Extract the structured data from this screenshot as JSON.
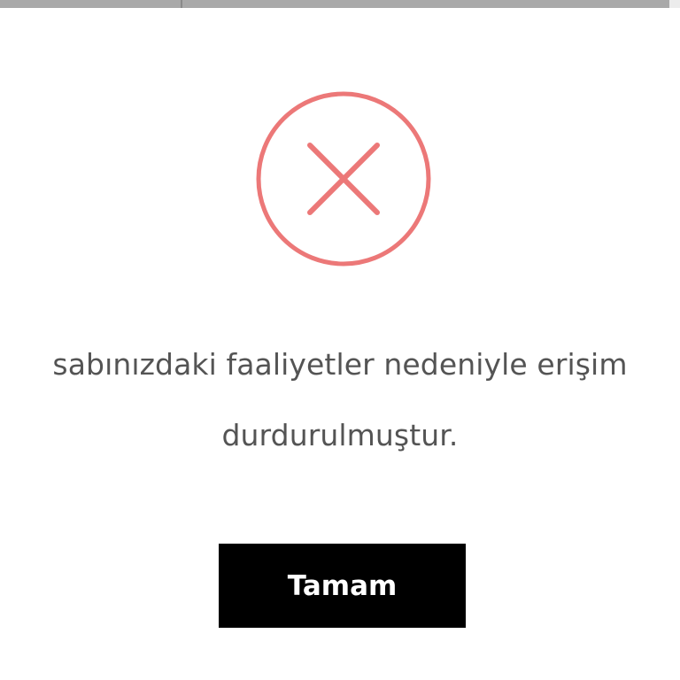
{
  "dialog": {
    "message_line_1": "sabınızdaki faaliyetler nedeniyle erişim",
    "message_line_2": "durdurulmuştur.",
    "ok_button_label": "Tamam",
    "icon": "close-icon"
  },
  "colors": {
    "error_accent": "#ec7878",
    "text": "#545454",
    "button_bg": "#000000",
    "button_text": "#ffffff"
  }
}
